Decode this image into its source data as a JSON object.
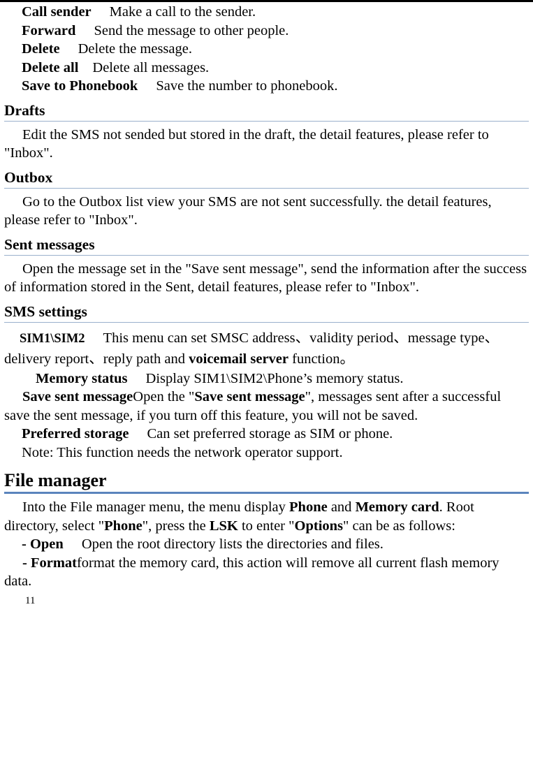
{
  "document": {
    "page_number": "11",
    "rule_color_h2": "#9ab0cc",
    "rule_color_h1": "#5b84bd"
  },
  "inbox_options": [
    {
      "term": "Call sender",
      "desc": "Make a call to the sender."
    },
    {
      "term": "Forward",
      "desc": "Send the message to other people."
    },
    {
      "term": "Delete",
      "desc": "Delete the message."
    },
    {
      "term": "Delete all",
      "desc": "Delete all messages."
    },
    {
      "term": "Save to Phonebook",
      "desc": "Save the number to phonebook."
    }
  ],
  "sections": {
    "drafts": {
      "heading": "Drafts",
      "body": "Edit the SMS not sended but stored in the draft, the detail features, please refer to \"Inbox\"."
    },
    "outbox": {
      "heading": "Outbox",
      "body": "Go to the Outbox list view your SMS are not sent successfully. the detail features, please refer to \"Inbox\"."
    },
    "sent_messages": {
      "heading": "Sent messages",
      "body": "Open the message set in the \"Save sent message\", send the information after the success of information stored in the Sent, detail features, please refer to \"Inbox\"."
    },
    "sms_settings": {
      "heading": "SMS settings",
      "sim_term": "SIM1\\SIM2",
      "sim_text_1": "This menu can set SMSC address、validity period、message type、delivery report、reply path and ",
      "sim_bold": "voicemail server",
      "sim_text_2": " function。",
      "memory_status_term": "Memory status",
      "memory_status_desc": "Display SIM1\\SIM2\\Phone’s memory status.",
      "save_sent_term": "Save sent message",
      "save_sent_text_1": "Open the \"",
      "save_sent_bold": "Save sent message",
      "save_sent_text_2": "\", messages sent after a successful save the sent message, if you turn off this feature, you will not be saved.",
      "preferred_storage_term": "Preferred storage",
      "preferred_storage_desc": "Can set preferred storage as SIM or phone.",
      "note": "Note: This function needs the network operator support."
    },
    "file_manager": {
      "heading": "File manager",
      "intro_1": "Into the File manager menu, the menu display ",
      "intro_bold_1": "Phone",
      "intro_2": " and ",
      "intro_bold_2": "Memory card",
      "intro_3": ". Root directory, select \"",
      "intro_bold_3": "Phone",
      "intro_4": "\", press the ",
      "intro_bold_4": "LSK",
      "intro_5": " to enter \"",
      "intro_bold_5": "Options",
      "intro_6": "\" can be as follows:",
      "open_term": "- Open",
      "open_desc": "Open the root directory lists the directories and files.",
      "format_term": "- Format",
      "format_text": "format the memory card, this action will remove all current flash memory data."
    }
  }
}
